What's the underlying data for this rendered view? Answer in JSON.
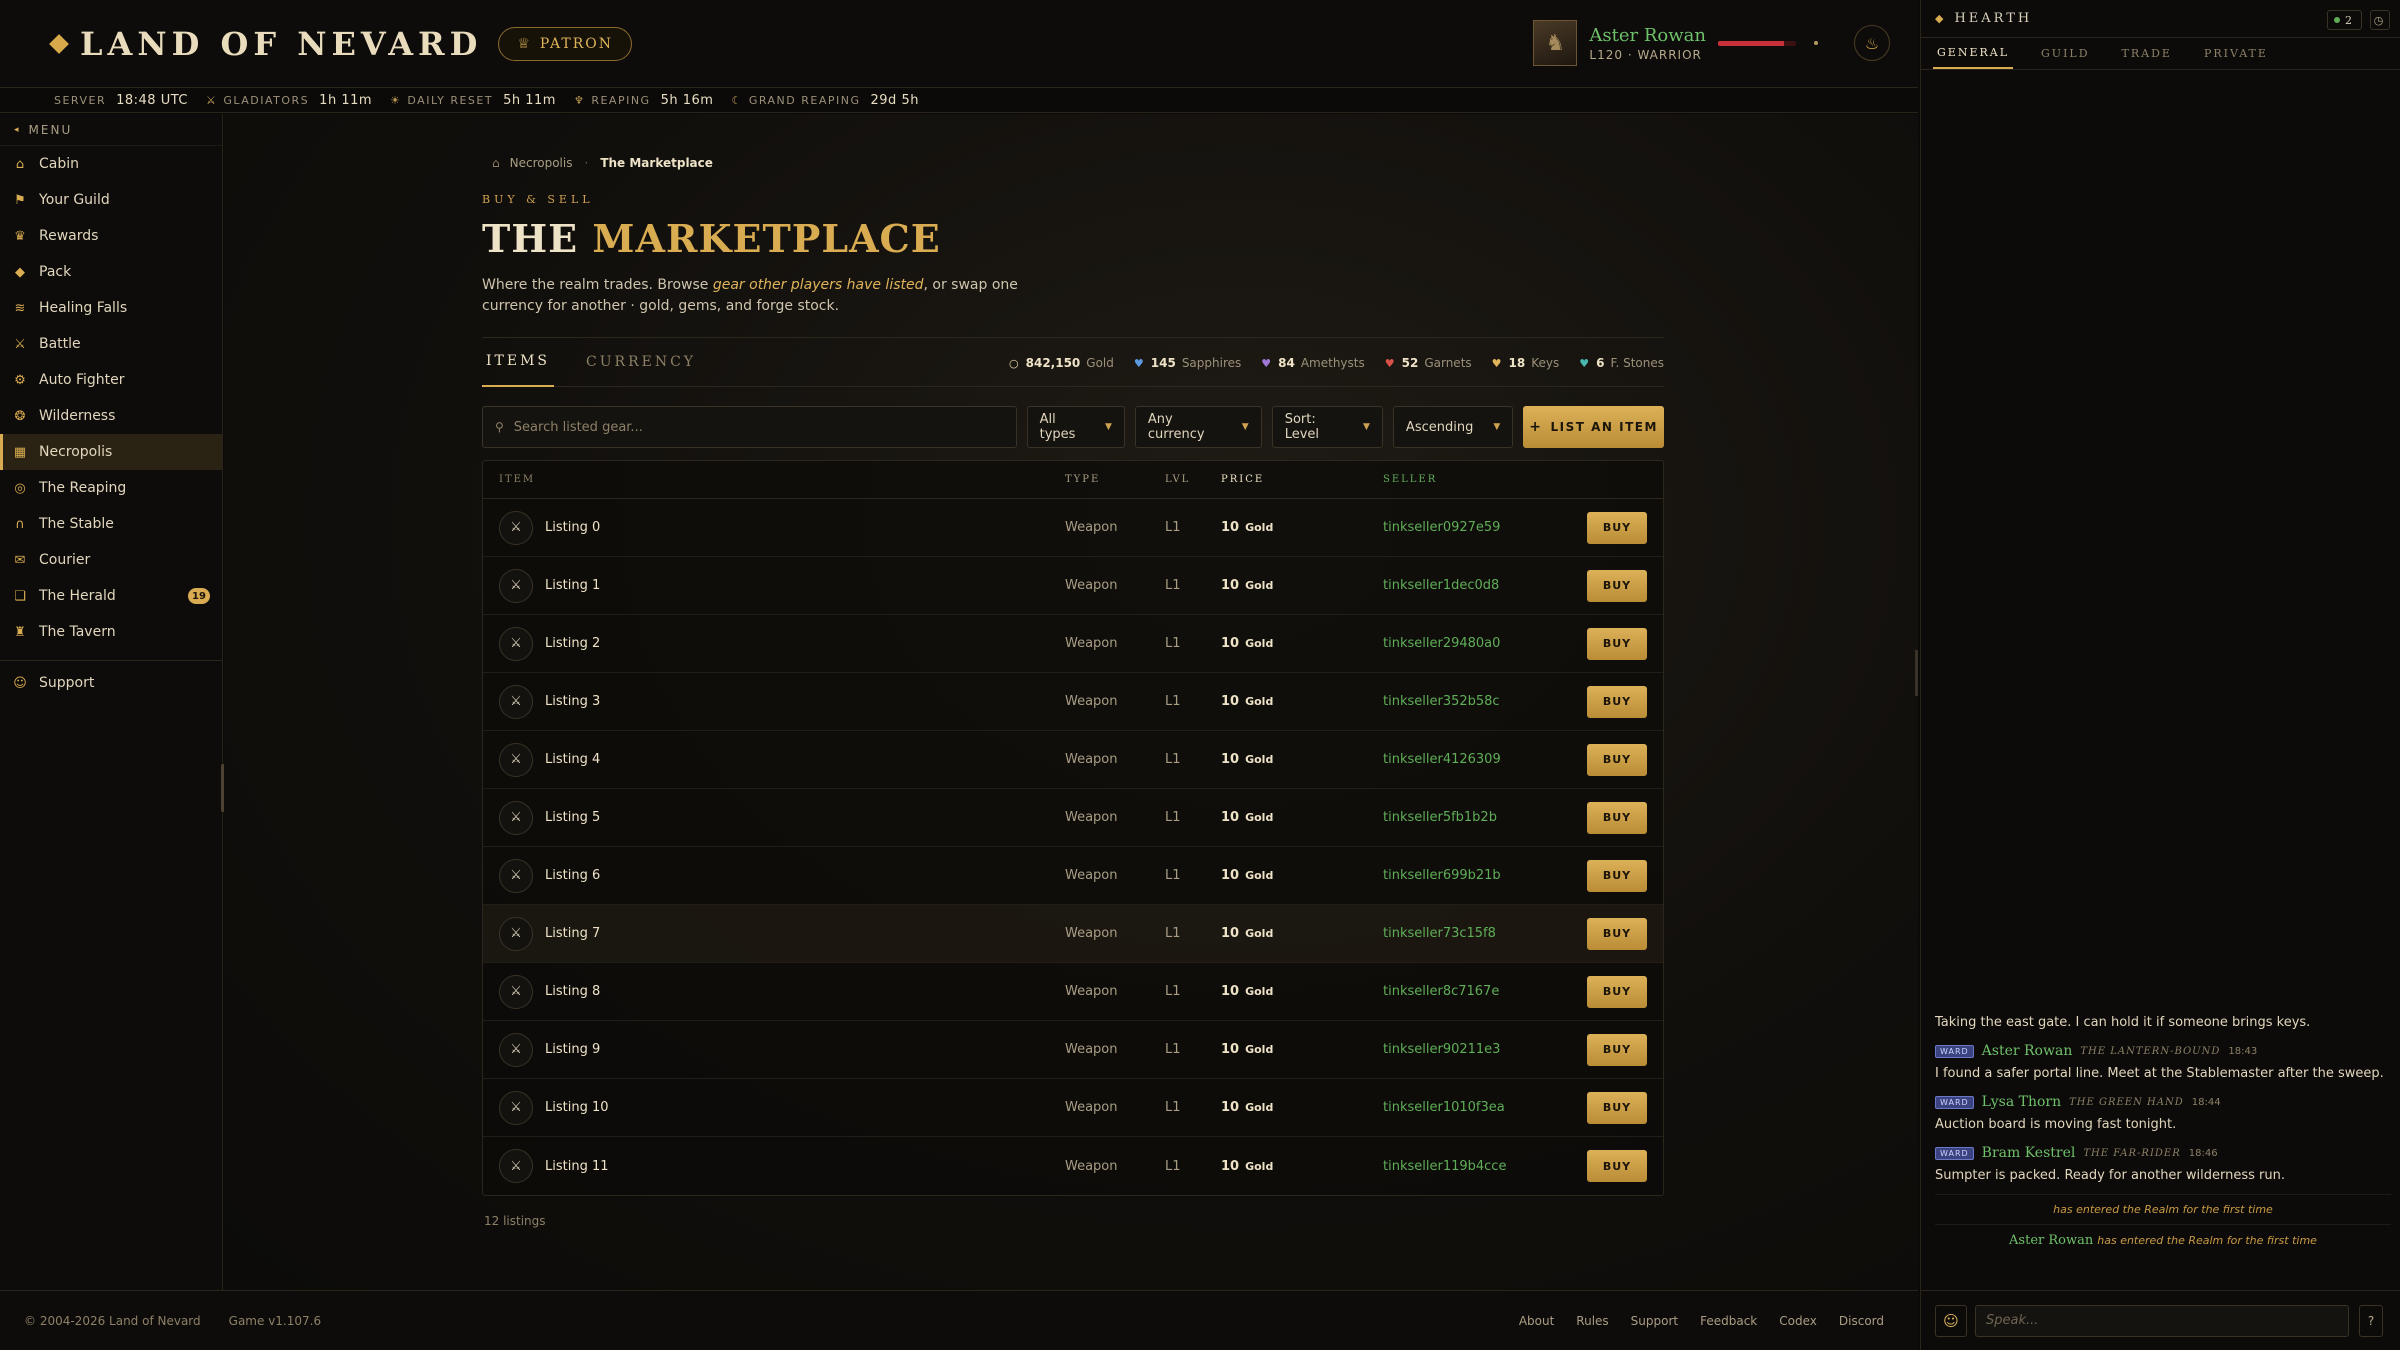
{
  "header": {
    "logo": "LAND OF NEVARD",
    "patron_label": "PATRON",
    "player": {
      "name": "Aster Rowan",
      "meta": "L120 · WARRIOR",
      "hp_fraction": 0.85
    }
  },
  "timers": [
    {
      "label": "SERVER",
      "value": "18:48 UTC",
      "icon": ""
    },
    {
      "label": "GLADIATORS",
      "value": "1h 11m",
      "icon": "swords-icon"
    },
    {
      "label": "DAILY RESET",
      "value": "5h 11m",
      "icon": "sun-icon"
    },
    {
      "label": "REAPING",
      "value": "5h 16m",
      "icon": "scythe-icon"
    },
    {
      "label": "GRAND REAPING",
      "value": "29d 5h",
      "icon": "moon-icon"
    }
  ],
  "sidebar": {
    "menu_label": "MENU",
    "items": [
      {
        "label": "Cabin",
        "icon": "cabin-icon",
        "glyph": "⌂"
      },
      {
        "label": "Your Guild",
        "icon": "guild-icon",
        "glyph": "⚑"
      },
      {
        "label": "Rewards",
        "icon": "rewards-icon",
        "glyph": "♛"
      },
      {
        "label": "Pack",
        "icon": "pack-icon",
        "glyph": "◆"
      },
      {
        "label": "Healing Falls",
        "icon": "falls-icon",
        "glyph": "≋"
      },
      {
        "label": "Battle",
        "icon": "battle-icon",
        "glyph": "⚔"
      },
      {
        "label": "Auto Fighter",
        "icon": "auto-fighter-icon",
        "glyph": "⚙"
      },
      {
        "label": "Wilderness",
        "icon": "wilderness-icon",
        "glyph": "❂"
      },
      {
        "label": "Necropolis",
        "icon": "necropolis-icon",
        "glyph": "▦",
        "active": true
      },
      {
        "label": "The Reaping",
        "icon": "reaping-icon",
        "glyph": "◎"
      },
      {
        "label": "The Stable",
        "icon": "stable-icon",
        "glyph": "∩"
      },
      {
        "label": "Courier",
        "icon": "courier-icon",
        "glyph": "✉"
      },
      {
        "label": "The Herald",
        "icon": "herald-icon",
        "glyph": "❏",
        "badge": "19"
      },
      {
        "label": "The Tavern",
        "icon": "tavern-icon",
        "glyph": "♜"
      }
    ],
    "support": {
      "label": "Support",
      "icon": "support-icon",
      "glyph": "☺"
    }
  },
  "main": {
    "breadcrumb": {
      "parent": "Necropolis",
      "current": "The Marketplace"
    },
    "kicker": "BUY & SELL",
    "title_a": "THE ",
    "title_b": "MARKETPLACE",
    "desc_1": "Where the realm trades. Browse ",
    "desc_em": "gear other players have listed",
    "desc_2": ", or swap one currency for another · gold, gems, and forge stock.",
    "tabs": [
      {
        "label": "ITEMS",
        "active": true
      },
      {
        "label": "CURRENCY",
        "active": false
      }
    ],
    "wallet": [
      {
        "value": "842,150",
        "label": "Gold",
        "color": "#e8d9b0",
        "glyph": "○"
      },
      {
        "value": "145",
        "label": "Sapphires",
        "color": "#5b9ae0",
        "glyph": "♥"
      },
      {
        "value": "84",
        "label": "Amethysts",
        "color": "#a078d8",
        "glyph": "♥"
      },
      {
        "value": "52",
        "label": "Garnets",
        "color": "#d8524a",
        "glyph": "♥"
      },
      {
        "value": "18",
        "label": "Keys",
        "color": "#e0b45a",
        "glyph": "♥"
      },
      {
        "value": "6",
        "label": "F. Stones",
        "color": "#4ab8b0",
        "glyph": "♥"
      }
    ],
    "search_placeholder": "Search listed gear...",
    "filters": {
      "type": "All types",
      "currency": "Any currency",
      "sort": "Sort: Level",
      "order": "Ascending",
      "list_button": "LIST AN ITEM"
    },
    "table": {
      "headers": {
        "item": "ITEM",
        "type": "TYPE",
        "lvl": "LVL",
        "price": "PRICE",
        "seller": "SELLER"
      },
      "buy_label": "BUY",
      "rows": [
        {
          "name": "Listing 0",
          "type": "Weapon",
          "lvl": "L1",
          "price": "10",
          "unit": "Gold",
          "seller": "tinkseller0927e59"
        },
        {
          "name": "Listing 1",
          "type": "Weapon",
          "lvl": "L1",
          "price": "10",
          "unit": "Gold",
          "seller": "tinkseller1dec0d8"
        },
        {
          "name": "Listing 2",
          "type": "Weapon",
          "lvl": "L1",
          "price": "10",
          "unit": "Gold",
          "seller": "tinkseller29480a0"
        },
        {
          "name": "Listing 3",
          "type": "Weapon",
          "lvl": "L1",
          "price": "10",
          "unit": "Gold",
          "seller": "tinkseller352b58c"
        },
        {
          "name": "Listing 4",
          "type": "Weapon",
          "lvl": "L1",
          "price": "10",
          "unit": "Gold",
          "seller": "tinkseller4126309"
        },
        {
          "name": "Listing 5",
          "type": "Weapon",
          "lvl": "L1",
          "price": "10",
          "unit": "Gold",
          "seller": "tinkseller5fb1b2b"
        },
        {
          "name": "Listing 6",
          "type": "Weapon",
          "lvl": "L1",
          "price": "10",
          "unit": "Gold",
          "seller": "tinkseller699b21b"
        },
        {
          "name": "Listing 7",
          "type": "Weapon",
          "lvl": "L1",
          "price": "10",
          "unit": "Gold",
          "seller": "tinkseller73c15f8"
        },
        {
          "name": "Listing 8",
          "type": "Weapon",
          "lvl": "L1",
          "price": "10",
          "unit": "Gold",
          "seller": "tinkseller8c7167e"
        },
        {
          "name": "Listing 9",
          "type": "Weapon",
          "lvl": "L1",
          "price": "10",
          "unit": "Gold",
          "seller": "tinkseller90211e3"
        },
        {
          "name": "Listing 10",
          "type": "Weapon",
          "lvl": "L1",
          "price": "10",
          "unit": "Gold",
          "seller": "tinkseller1010f3ea"
        },
        {
          "name": "Listing 11",
          "type": "Weapon",
          "lvl": "L1",
          "price": "10",
          "unit": "Gold",
          "seller": "tinkseller119b4cce"
        }
      ]
    },
    "count": "12 listings"
  },
  "footer": {
    "copyright": "© 2004-2026 Land of Nevard",
    "version": "Game v1.107.6",
    "links": [
      "About",
      "Rules",
      "Support",
      "Feedback",
      "Codex",
      "Discord"
    ]
  },
  "chat": {
    "title": "HEARTH",
    "online": "2",
    "tabs": [
      "GENERAL",
      "GUILD",
      "TRADE",
      "PRIVATE"
    ],
    "messages": [
      {
        "name": "Aster Rowan",
        "title": "THE LANTERN-BOUND",
        "time": "18:43",
        "text": "I found a safer portal line. Meet at the Stablemaster after the sweep.",
        "tag": "WARD"
      },
      {
        "name": "Lysa Thorn",
        "title": "THE GREEN HAND",
        "time": "18:44",
        "text": "Auction board is moving fast tonight.",
        "tag": "WARD"
      },
      {
        "name": "Bram Kestrel",
        "title": "THE FAR-RIDER",
        "time": "18:46",
        "text": "Sumpter is packed. Ready for another wilderness run.",
        "tag": "WARD"
      }
    ],
    "partial_text": "Taking the east gate. I can hold it if someone brings keys.",
    "system_1": "has entered the Realm for the first time",
    "system_2_name": "Aster Rowan",
    "system_2": "has entered the Realm for the first time",
    "input_placeholder": "Speak...",
    "help": "?"
  }
}
